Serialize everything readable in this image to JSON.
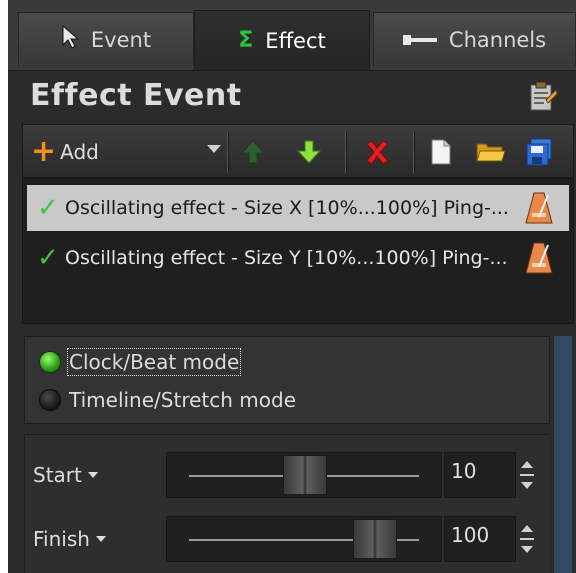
{
  "tabs": [
    {
      "label": "Event",
      "icon": "cursor-arrow-icon"
    },
    {
      "label": "Effect",
      "icon": "sigma-icon"
    },
    {
      "label": "Channels",
      "icon": "channel-plug-icon"
    }
  ],
  "panel": {
    "title": "Effect Event"
  },
  "toolbar": {
    "add_label": "Add"
  },
  "effects": [
    {
      "label": "Oscillating effect - Size X [10%...100%] Ping-...",
      "selected": true
    },
    {
      "label": "Oscillating effect - Size Y [10%...100%] Ping-...",
      "selected": false
    }
  ],
  "mode": {
    "clock_label": "Clock/Beat mode",
    "timeline_label": "Timeline/Stretch mode",
    "selected": "clock"
  },
  "sliders": {
    "start": {
      "label": "Start",
      "value": "10",
      "fraction": 0.5
    },
    "finish": {
      "label": "Finish",
      "value": "100",
      "fraction": 0.8
    }
  },
  "colors": {
    "accent_green": "#3cc63c",
    "add_orange": "#f28c1a",
    "delete_red": "#e02020",
    "frame_bg": "#2b2b2b"
  }
}
